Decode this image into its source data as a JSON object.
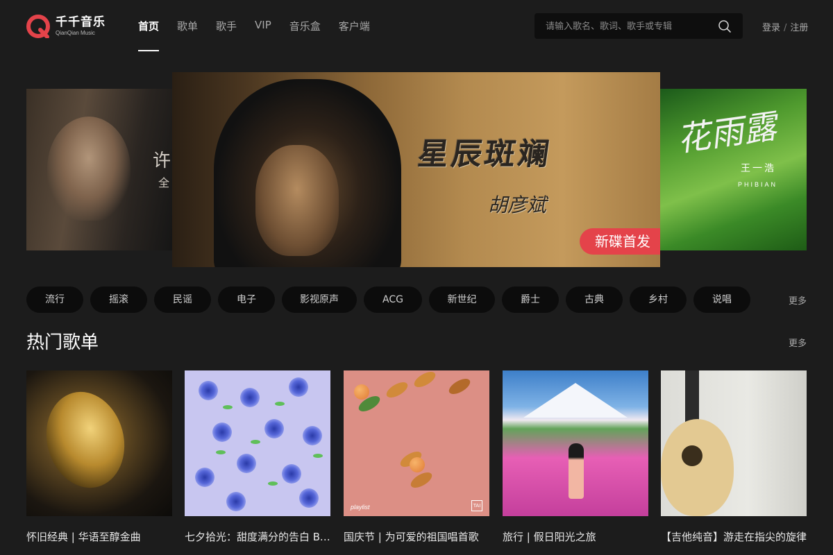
{
  "header": {
    "logo_cn": "千千音乐",
    "logo_en": "QianQian Music",
    "nav": [
      {
        "label": "首页",
        "active": true
      },
      {
        "label": "歌单",
        "active": false
      },
      {
        "label": "歌手",
        "active": false
      },
      {
        "label": "VIP",
        "active": false
      },
      {
        "label": "音乐盒",
        "active": false
      },
      {
        "label": "客户端",
        "active": false
      }
    ],
    "search_placeholder": "请输入歌名、歌词、歌手或专辑",
    "login": "登录",
    "separator": "/",
    "register": "注册"
  },
  "carousel": {
    "left": {
      "text_large": "许",
      "text_small": "全"
    },
    "main": {
      "album_title": "星辰斑斓",
      "artist_signature": "胡彦斌",
      "badge": "新碟首发"
    },
    "right": {
      "calligraphy": "花雨露",
      "artist": "王一浩",
      "artist_en": "PHIBIAN"
    }
  },
  "genres": {
    "items": [
      "流行",
      "摇滚",
      "民谣",
      "电子",
      "影视原声",
      "ACG",
      "新世纪",
      "爵士",
      "古典",
      "乡村",
      "说唱"
    ],
    "more": "更多"
  },
  "hot_playlists": {
    "title": "热门歌单",
    "more": "更多",
    "items": [
      {
        "title": "怀旧经典 | 华语至醇金曲"
      },
      {
        "title": "七夕拾光：甜度满分的告白 BGM"
      },
      {
        "title": "国庆节 | 为可爱的祖国唱首歌",
        "cover_tag": "playlist",
        "cover_badge": "TAI"
      },
      {
        "title": "旅行 | 假日阳光之旅"
      },
      {
        "title": "【吉他纯音】游走在指尖的旋律"
      }
    ]
  },
  "colors": {
    "background": "#1c1c1c",
    "brand_red": "#e4434a",
    "chip_bg": "#0c0c0c"
  }
}
